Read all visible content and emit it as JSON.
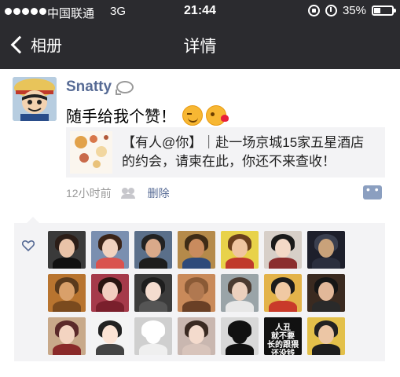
{
  "status_bar": {
    "carrier": "中国联通",
    "network": "3G",
    "time": "21:44",
    "battery": "35%",
    "battery_level": 0.35
  },
  "nav": {
    "back_label": "相册",
    "title": "详情"
  },
  "post": {
    "author": "Snatty",
    "text": "随手给我个赞！",
    "link": {
      "text": "【有人@你】｜赴一场京城15家五星酒店的约会，请柬在此，你还不来查收！"
    },
    "time": "12小时前",
    "delete_label": "删除"
  },
  "likes": {
    "avatars": [
      {
        "bg": "#3a3a3a",
        "hair": "#2b1d17",
        "face": "#e9c3a8",
        "body": "#111111"
      },
      {
        "bg": "#7a8fb0",
        "hair": "#3b2418",
        "face": "#f1d2bf",
        "body": "#d9534f"
      },
      {
        "bg": "#5a6f8a",
        "hair": "#222222",
        "face": "#d9a98a",
        "body": "#1d1d1d"
      },
      {
        "bg": "#b58a4a",
        "hair": "#3e2b16",
        "face": "#c98b5e",
        "body": "#2e4a7a"
      },
      {
        "bg": "#e8d24a",
        "hair": "#6b3f1d",
        "face": "#f0c5a0",
        "body": "#c0392b"
      },
      {
        "bg": "#d7cfc8",
        "hair": "#1a1a1a",
        "face": "#f3d9c7",
        "body": "#8b2e2e"
      },
      {
        "bg": "#1d1f2b",
        "hair": "#3a3f4f",
        "face": "#c9a27a",
        "body": "#2b2f3e"
      },
      {
        "bg": "#b8742f",
        "hair": "#5a3a1c",
        "face": "#d9a06a",
        "body": "#7a4a1e"
      },
      {
        "bg": "#a53a4a",
        "hair": "#2a1410",
        "face": "#f2cdbf",
        "body": "#7a1f2c"
      },
      {
        "bg": "#3c3c3c",
        "hair": "#1e1e1e",
        "face": "#f4dccf",
        "body": "#555555"
      },
      {
        "bg": "#c98a5a",
        "hair": "#8a5a36",
        "face": "#b07850",
        "body": "#6a4026"
      },
      {
        "bg": "#9aa4a8",
        "hair": "#4a3a30",
        "face": "#ecd0bd",
        "body": "#e7e7e7"
      },
      {
        "bg": "#e3b34a",
        "hair": "#1c1c1c",
        "face": "#f0c9a3",
        "body": "#c93a2a"
      },
      {
        "bg": "#3a2a20",
        "hair": "#161616",
        "face": "#e2b899",
        "body": "#2a2a2a"
      },
      {
        "bg": "#c8a98a",
        "hair": "#5b2a2a",
        "face": "#f3d4c1",
        "body": "#8a2a2a"
      },
      {
        "bg": "#f4f4f4",
        "hair": "#222222",
        "face": "#fbe3d4",
        "body": "#444444"
      },
      {
        "bg": "#cfcfcf",
        "hair": "#ffffff",
        "face": "#ffffff",
        "body": "#efefef"
      },
      {
        "bg": "#c9b7b0",
        "hair": "#3a2a22",
        "face": "#f4dbcd",
        "body": "#d8c4bb"
      },
      {
        "bg": "#d8d8d8",
        "hair": "#111111",
        "face": "#111111",
        "body": "#111111"
      },
      {
        "bg": "#111111",
        "hair": "#111111",
        "face": "#111111",
        "body": "#111111",
        "word": "人丑\n就不要\n长的跟猥\n还没钱"
      },
      {
        "bg": "#e3c04a",
        "hair": "#222222",
        "face": "#ecc6a5",
        "body": "#1e1e1e"
      }
    ]
  },
  "colors": {
    "nav_bg": "#2b2b2f",
    "name_blue": "#576b95",
    "card_bg": "#f3f3f5"
  }
}
